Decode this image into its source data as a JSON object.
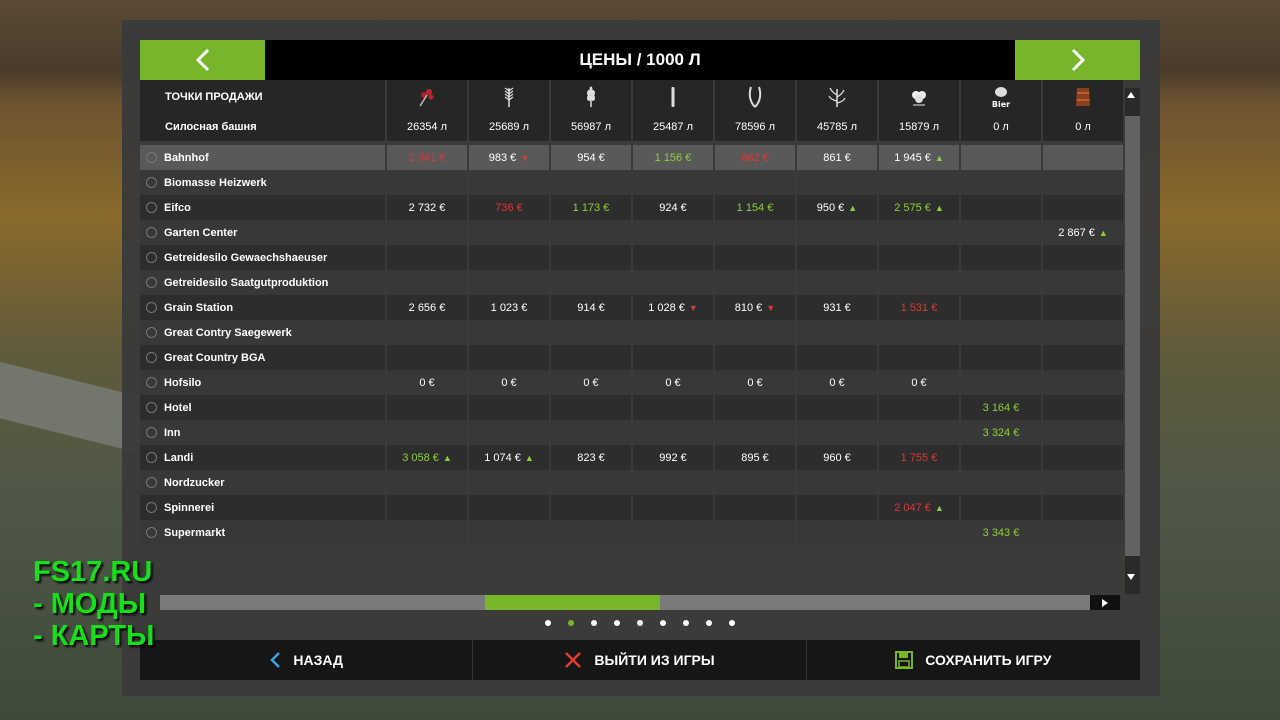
{
  "title": "ЦЕНЫ / 1000 Л",
  "nav": {
    "prev_icon": "chevron-left-icon",
    "next_icon": "chevron-right-icon"
  },
  "table": {
    "header_label": "ТОЧКИ ПРОДАЖИ",
    "columns": [
      {
        "icon": "canola-icon"
      },
      {
        "icon": "barley-icon"
      },
      {
        "icon": "wheat-icon"
      },
      {
        "icon": "stalk-icon"
      },
      {
        "icon": "sunflower-seeds-icon"
      },
      {
        "icon": "corn-icon"
      },
      {
        "icon": "cotton-icon"
      },
      {
        "icon": "bier-icon",
        "label": "Bier"
      },
      {
        "icon": "barrel-icon"
      }
    ],
    "summary": {
      "label": "Силосная башня",
      "values": [
        "26354 л",
        "25689 л",
        "56987 л",
        "25487 л",
        "78596 л",
        "45785 л",
        "15879 л",
        "0 л",
        "0 л"
      ]
    },
    "rows": [
      {
        "name": "Bahnhof",
        "cells": [
          {
            "v": "2 341 €",
            "c": "red"
          },
          {
            "v": "983 €",
            "t": "down"
          },
          {
            "v": "954 €"
          },
          {
            "v": "1 156 €",
            "c": "green"
          },
          {
            "v": "662 €",
            "c": "red"
          },
          {
            "v": "861 €"
          },
          {
            "v": "1 945 €",
            "t": "up"
          },
          {
            "v": ""
          },
          {
            "v": ""
          }
        ]
      },
      {
        "name": "Biomasse Heizwerk",
        "cells": [
          {
            "v": ""
          },
          {
            "v": ""
          },
          {
            "v": ""
          },
          {
            "v": ""
          },
          {
            "v": ""
          },
          {
            "v": ""
          },
          {
            "v": ""
          },
          {
            "v": ""
          },
          {
            "v": ""
          }
        ]
      },
      {
        "name": "Eifco",
        "cells": [
          {
            "v": "2 732 €"
          },
          {
            "v": "736 €",
            "c": "red"
          },
          {
            "v": "1 173 €",
            "c": "green"
          },
          {
            "v": "924 €"
          },
          {
            "v": "1 154 €",
            "c": "green"
          },
          {
            "v": "950 €",
            "t": "up"
          },
          {
            "v": "2 575 €",
            "c": "green",
            "t": "up"
          },
          {
            "v": ""
          },
          {
            "v": ""
          }
        ]
      },
      {
        "name": "Garten Center",
        "cells": [
          {
            "v": ""
          },
          {
            "v": ""
          },
          {
            "v": ""
          },
          {
            "v": ""
          },
          {
            "v": ""
          },
          {
            "v": ""
          },
          {
            "v": ""
          },
          {
            "v": ""
          },
          {
            "v": "2 867 €",
            "t": "up"
          }
        ]
      },
      {
        "name": "Getreidesilo Gewaechshaeuser",
        "cells": [
          {
            "v": ""
          },
          {
            "v": ""
          },
          {
            "v": ""
          },
          {
            "v": ""
          },
          {
            "v": ""
          },
          {
            "v": ""
          },
          {
            "v": ""
          },
          {
            "v": ""
          },
          {
            "v": ""
          }
        ]
      },
      {
        "name": "Getreidesilo Saatgutproduktion",
        "cells": [
          {
            "v": ""
          },
          {
            "v": ""
          },
          {
            "v": ""
          },
          {
            "v": ""
          },
          {
            "v": ""
          },
          {
            "v": ""
          },
          {
            "v": ""
          },
          {
            "v": ""
          },
          {
            "v": ""
          }
        ]
      },
      {
        "name": "Grain Station",
        "cells": [
          {
            "v": "2 656 €"
          },
          {
            "v": "1 023 €"
          },
          {
            "v": "914 €"
          },
          {
            "v": "1 028 €",
            "t": "down"
          },
          {
            "v": "810 €",
            "t": "down"
          },
          {
            "v": "931 €"
          },
          {
            "v": "1 531 €",
            "c": "red"
          },
          {
            "v": ""
          },
          {
            "v": ""
          }
        ]
      },
      {
        "name": "Great Contry Saegewerk",
        "cells": [
          {
            "v": ""
          },
          {
            "v": ""
          },
          {
            "v": ""
          },
          {
            "v": ""
          },
          {
            "v": ""
          },
          {
            "v": ""
          },
          {
            "v": ""
          },
          {
            "v": ""
          },
          {
            "v": ""
          }
        ]
      },
      {
        "name": "Great Country BGA",
        "cells": [
          {
            "v": ""
          },
          {
            "v": ""
          },
          {
            "v": ""
          },
          {
            "v": ""
          },
          {
            "v": ""
          },
          {
            "v": ""
          },
          {
            "v": ""
          },
          {
            "v": ""
          },
          {
            "v": ""
          }
        ]
      },
      {
        "name": "Hofsilo",
        "cells": [
          {
            "v": "0 €"
          },
          {
            "v": "0 €"
          },
          {
            "v": "0 €"
          },
          {
            "v": "0 €"
          },
          {
            "v": "0 €"
          },
          {
            "v": "0 €"
          },
          {
            "v": "0 €"
          },
          {
            "v": ""
          },
          {
            "v": ""
          }
        ]
      },
      {
        "name": "Hotel",
        "cells": [
          {
            "v": ""
          },
          {
            "v": ""
          },
          {
            "v": ""
          },
          {
            "v": ""
          },
          {
            "v": ""
          },
          {
            "v": ""
          },
          {
            "v": ""
          },
          {
            "v": "3 164 €",
            "c": "green"
          },
          {
            "v": ""
          }
        ]
      },
      {
        "name": "Inn",
        "cells": [
          {
            "v": ""
          },
          {
            "v": ""
          },
          {
            "v": ""
          },
          {
            "v": ""
          },
          {
            "v": ""
          },
          {
            "v": ""
          },
          {
            "v": ""
          },
          {
            "v": "3 324 €",
            "c": "green"
          },
          {
            "v": ""
          }
        ]
      },
      {
        "name": "Landi",
        "cells": [
          {
            "v": "3 058 €",
            "c": "green",
            "t": "up"
          },
          {
            "v": "1 074 €",
            "t": "up"
          },
          {
            "v": "823 €"
          },
          {
            "v": "992 €"
          },
          {
            "v": "895 €"
          },
          {
            "v": "960 €"
          },
          {
            "v": "1 755 €",
            "c": "red"
          },
          {
            "v": ""
          },
          {
            "v": ""
          }
        ]
      },
      {
        "name": "Nordzucker",
        "cells": [
          {
            "v": ""
          },
          {
            "v": ""
          },
          {
            "v": ""
          },
          {
            "v": ""
          },
          {
            "v": ""
          },
          {
            "v": ""
          },
          {
            "v": ""
          },
          {
            "v": ""
          },
          {
            "v": ""
          }
        ]
      },
      {
        "name": "Spinnerei",
        "cells": [
          {
            "v": ""
          },
          {
            "v": ""
          },
          {
            "v": ""
          },
          {
            "v": ""
          },
          {
            "v": ""
          },
          {
            "v": ""
          },
          {
            "v": "2 047 €",
            "c": "red",
            "t": "up"
          },
          {
            "v": ""
          },
          {
            "v": ""
          }
        ]
      },
      {
        "name": "Supermarkt",
        "cells": [
          {
            "v": ""
          },
          {
            "v": ""
          },
          {
            "v": ""
          },
          {
            "v": ""
          },
          {
            "v": ""
          },
          {
            "v": ""
          },
          {
            "v": ""
          },
          {
            "v": "3 343 €",
            "c": "green"
          },
          {
            "v": ""
          }
        ]
      }
    ]
  },
  "pager": {
    "count": 9,
    "active": 1
  },
  "bottom": {
    "back": "НАЗАД",
    "quit": "ВЫЙТИ ИЗ ИГРЫ",
    "save": "СОХРАНИТЬ ИГРУ"
  },
  "watermark": [
    "FS17.RU",
    "- МОДЫ",
    "- КАРТЫ"
  ],
  "colors": {
    "accent": "#77b62a",
    "price_up": "#8cd13a",
    "price_down": "#d93a34"
  }
}
